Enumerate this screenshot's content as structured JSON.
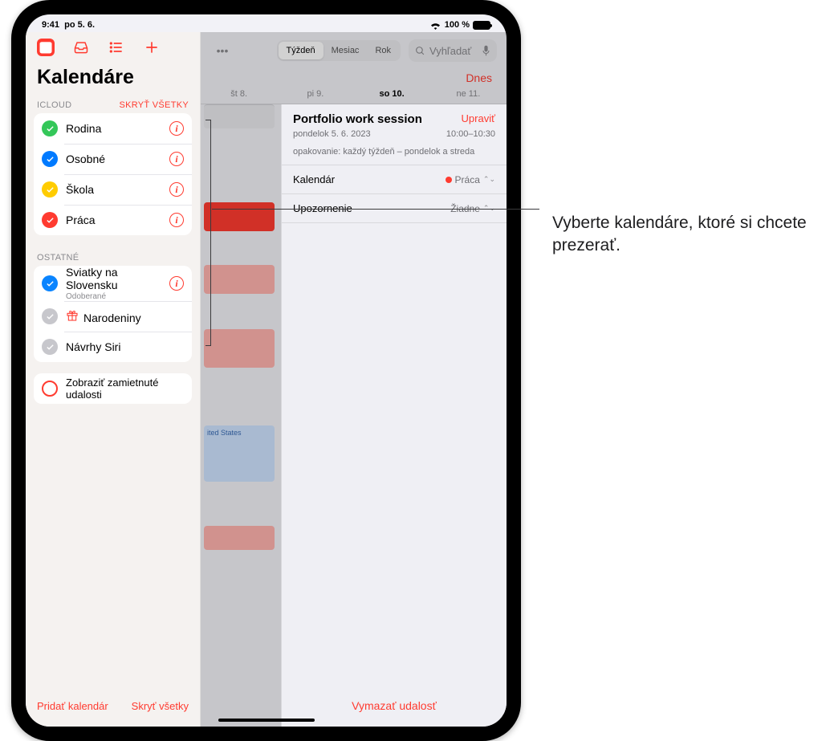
{
  "status": {
    "time": "9:41",
    "date": "po 5. 6.",
    "battery": "100 %"
  },
  "sidebar": {
    "title": "Kalendáre",
    "sections": [
      {
        "label": "ICLOUD",
        "action": "SKRYŤ VŠETKY",
        "items": [
          {
            "name": "Rodina",
            "color": "#34c759",
            "checked": true,
            "info": true
          },
          {
            "name": "Osobné",
            "color": "#007aff",
            "checked": true,
            "info": true
          },
          {
            "name": "Škola",
            "color": "#ffcc00",
            "checked": true,
            "info": true
          },
          {
            "name": "Práca",
            "color": "#ff3b30",
            "checked": true,
            "info": true
          }
        ]
      },
      {
        "label": "OSTATNÉ",
        "items": [
          {
            "name": "Sviatky na Slovensku",
            "sub": "Odoberané",
            "color": "#0a84ff",
            "checked": true,
            "info": true
          },
          {
            "name": "Narodeniny",
            "color": "#c7c7cc",
            "checked": true,
            "gift": true
          },
          {
            "name": "Návrhy Siri",
            "color": "#c7c7cc",
            "checked": true
          }
        ]
      }
    ],
    "declined": "Zobraziť zamietnuté udalosti",
    "footer": {
      "add": "Pridať kalendár",
      "hide": "Skryť všetky"
    }
  },
  "main": {
    "segments": [
      "Týždeň",
      "Mesiac",
      "Rok"
    ],
    "segment_active": 0,
    "search_placeholder": "Vyhľadať",
    "today": "Dnes",
    "days": [
      "št 8.",
      "pi 9.",
      "so 10.",
      "ne 11."
    ],
    "event": {
      "title": "Portfolio work session",
      "edit": "Upraviť",
      "date": "pondelok 5. 6. 2023",
      "time": "10:00–10:30",
      "repeat": "opakovanie: každý týždeň – pondelok a streda",
      "rows": [
        {
          "label": "Kalendár",
          "value": "Práca",
          "dot": "#ff3b30"
        },
        {
          "label": "Upozornenie",
          "value": "Žiadne"
        }
      ],
      "delete": "Vymazať udalosť"
    },
    "timeline_snippet": "ited States"
  },
  "annotation": "Vyberte kalendáre, ktoré si chcete prezerať."
}
